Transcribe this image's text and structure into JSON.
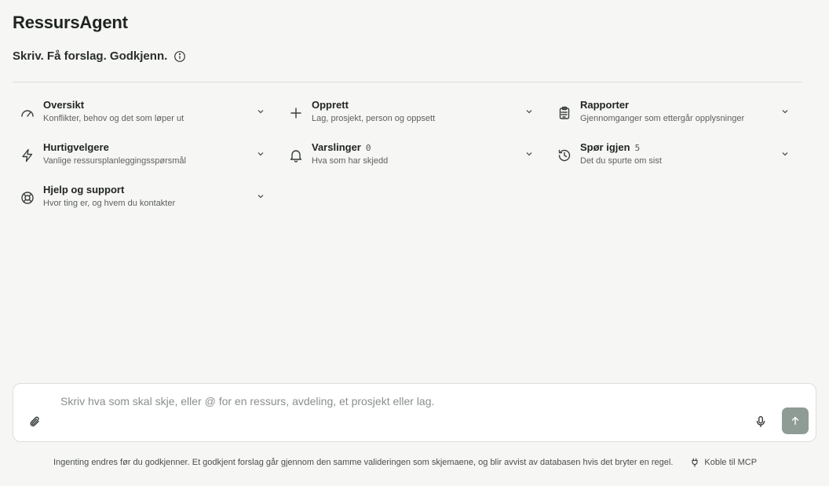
{
  "app": {
    "title": "RessursAgent",
    "subtitle": "Skriv. Få forslag. Godkjenn."
  },
  "items": [
    {
      "title": "Oversikt",
      "desc": "Konflikter, behov og det som løper ut",
      "icon": "gauge-icon"
    },
    {
      "title": "Opprett",
      "desc": "Lag, prosjekt, person og oppsett",
      "icon": "plus-icon"
    },
    {
      "title": "Rapporter",
      "desc": "Gjennomganger som ettergår opplysninger",
      "icon": "clipboard-icon"
    },
    {
      "title": "Hurtigvelgere",
      "desc": "Vanlige ressursplanleggingsspørsmål",
      "icon": "lightning-icon"
    },
    {
      "title": "Varslinger",
      "count": "0",
      "desc": "Hva som har skjedd",
      "icon": "bell-icon"
    },
    {
      "title": "Spør igjen",
      "count": "5",
      "desc": "Det du spurte om sist",
      "icon": "history-icon"
    },
    {
      "title": "Hjelp og support",
      "desc": "Hvor ting er, og hvem du kontakter",
      "icon": "lifebuoy-icon"
    }
  ],
  "composer": {
    "placeholder": "Skriv hva som skal skje, eller @ for en ressurs, avdeling, et prosjekt eller lag."
  },
  "footer": {
    "note": "Ingenting endres før du godkjenner. Et godkjent forslag går gjennom den samme valideringen som skjemaene, og blir avvist av databasen hvis det bryter en regel.",
    "mcp_label": "Koble til MCP"
  },
  "colors": {
    "background": "#f6f6f4",
    "send_button": "#8f9c95",
    "text": "#1f2422"
  }
}
